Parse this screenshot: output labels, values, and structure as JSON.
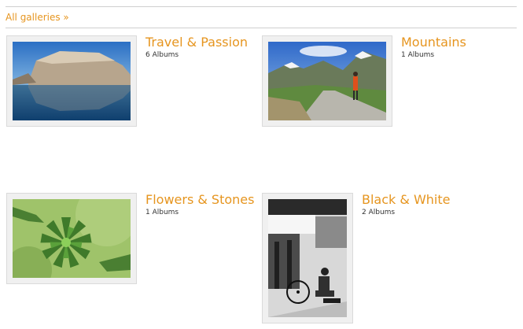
{
  "nav": {
    "all_galleries": "All galleries »"
  },
  "galleries": [
    {
      "title": "Travel & Passion",
      "count": "6 Albums",
      "image": "lake-cliff-reflection-photo"
    },
    {
      "title": "Mountains",
      "count": "1 Albums",
      "image": "hiker-mountain-path-photo"
    },
    {
      "title": "Flowers & Stones",
      "count": "1 Albums",
      "image": "green-succulent-closeup-photo"
    },
    {
      "title": "Black & White",
      "count": "2 Albums",
      "image": "street-vendor-bw-photo"
    }
  ],
  "colors": {
    "accent": "#e6951f",
    "text": "#333333",
    "frame": "#f0f0f0"
  }
}
